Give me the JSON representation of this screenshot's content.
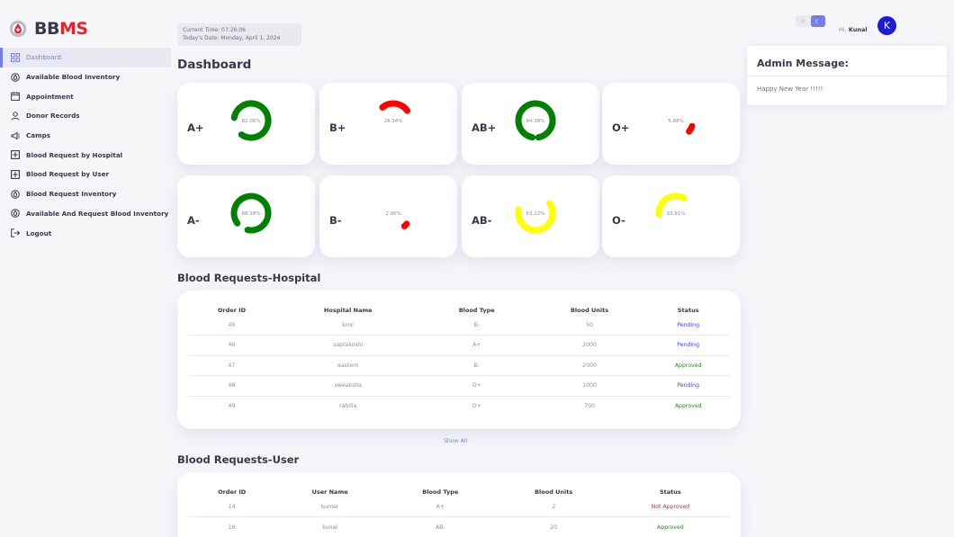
{
  "app": {
    "logo_bb": "BB",
    "logo_ms": "MS"
  },
  "sidebar": {
    "items": [
      {
        "label": "Dashboard",
        "icon": "grid-icon"
      },
      {
        "label": "Available Blood Inventory",
        "icon": "droplet-icon"
      },
      {
        "label": "Appointment",
        "icon": "calendar-icon"
      },
      {
        "label": "Donor Records",
        "icon": "user-icon"
      },
      {
        "label": "Camps",
        "icon": "megaphone-icon"
      },
      {
        "label": "Blood Request by Hospital",
        "icon": "plus-box-icon"
      },
      {
        "label": "Blood Request by User",
        "icon": "plus-box-icon"
      },
      {
        "label": "Blood Request Inventory",
        "icon": "droplet-icon"
      },
      {
        "label": "Available And Request Blood Inventory",
        "icon": "droplet-icon"
      },
      {
        "label": "Logout",
        "icon": "logout-icon"
      }
    ]
  },
  "header": {
    "current_time": "Current Time: 07:26:06",
    "today_date": "Today's Date: Monday, April 1, 2024",
    "title": "Dashboard"
  },
  "blood_cards": [
    {
      "group": "A+",
      "percent": 82.06,
      "percent_label": "82.06%",
      "color": "#008000"
    },
    {
      "group": "B+",
      "percent": 26.34,
      "percent_label": "26.34%",
      "color": "#ff0000"
    },
    {
      "group": "AB+",
      "percent": 94.38,
      "percent_label": "94.38%",
      "color": "#008000"
    },
    {
      "group": "O+",
      "percent": 5.68,
      "percent_label": "5.68%",
      "color": "#ff0000"
    },
    {
      "group": "A-",
      "percent": 88.38,
      "percent_label": "88.38%",
      "color": "#008000"
    },
    {
      "group": "B-",
      "percent": 2.95,
      "percent_label": "2.95%",
      "color": "#ff0000"
    },
    {
      "group": "AB-",
      "percent": 63.22,
      "percent_label": "63.22%",
      "color": "#ffff00"
    },
    {
      "group": "O-",
      "percent": 33.91,
      "percent_label": "33.91%",
      "color": "#ffff00"
    }
  ],
  "hospital_requests": {
    "title": "Blood Requests-Hospital",
    "columns": [
      "Order ID",
      "Hospital Name",
      "Blood Type",
      "Blood Units",
      "Status"
    ],
    "rows": [
      {
        "id": "45",
        "name": "kmc",
        "type": "B-",
        "units": "50",
        "status": "Pending",
        "status_class": "st-pending"
      },
      {
        "id": "46",
        "name": "saptakoshi",
        "type": "A+",
        "units": "2000",
        "status": "Pending",
        "status_class": "st-pending"
      },
      {
        "id": "47",
        "name": "eastern",
        "type": "B-",
        "units": "2000",
        "status": "Approved",
        "status_class": "st-approved"
      },
      {
        "id": "48",
        "name": "sweaksha",
        "type": "O+",
        "units": "1000",
        "status": "Pending",
        "status_class": "st-pending"
      },
      {
        "id": "49",
        "name": "rahilla",
        "type": "O+",
        "units": "700",
        "status": "Approved",
        "status_class": "st-approved"
      }
    ],
    "show_all": "Show All"
  },
  "user_requests": {
    "title": "Blood Requests-User",
    "columns": [
      "Order ID",
      "User Name",
      "Blood Type",
      "Blood Units",
      "Status"
    ],
    "rows": [
      {
        "id": "14",
        "name": "kumar",
        "type": "A+",
        "units": "2",
        "status": "Not Approved",
        "status_class": "st-notapproved"
      },
      {
        "id": "16",
        "name": "kunal",
        "type": "AB-",
        "units": "20",
        "status": "Approved",
        "status_class": "st-approved"
      }
    ]
  },
  "topbar": {
    "light_icon": "sun-icon",
    "dark_icon": "moon-icon",
    "greeting_prefix": "Hi, ",
    "user_name": "Kunal",
    "avatar_letter": "K"
  },
  "admin": {
    "title": "Admin Message:",
    "message": "Happy New Year !!!!!"
  }
}
